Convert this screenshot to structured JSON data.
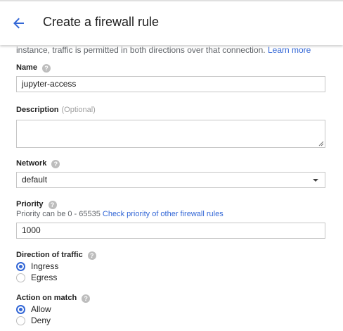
{
  "header": {
    "title": "Create a firewall rule"
  },
  "intro": {
    "text": "instance, traffic is permitted in both directions over that connection. ",
    "learn_more": "Learn more"
  },
  "name": {
    "label": "Name",
    "value": "jupyter-access"
  },
  "description": {
    "label": "Description",
    "optional": "(Optional)",
    "value": ""
  },
  "network": {
    "label": "Network",
    "selected": "default"
  },
  "priority": {
    "label": "Priority",
    "hint": "Priority can be 0 - 65535 ",
    "hint_link": "Check priority of other firewall rules",
    "value": "1000"
  },
  "direction": {
    "label": "Direction of traffic",
    "options": [
      "Ingress",
      "Egress"
    ],
    "selected": "Ingress"
  },
  "action": {
    "label": "Action on match",
    "options": [
      "Allow",
      "Deny"
    ],
    "selected": "Allow"
  },
  "help_glyph": "?",
  "colors": {
    "accent": "#3367d6",
    "help_icon": "#bdbdbd"
  }
}
